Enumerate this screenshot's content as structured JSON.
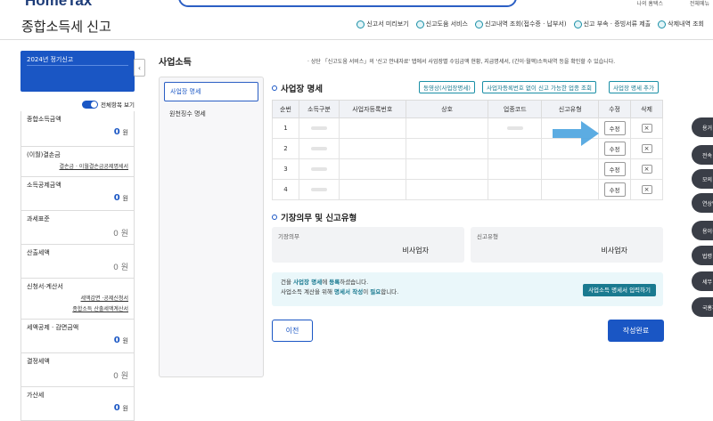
{
  "header": {
    "logo": "HomeTax",
    "top_links": [
      "나의 홈택스",
      "전체메뉴"
    ],
    "page_title": "종합소득세 신고",
    "nav": [
      {
        "label": "신고서 미리보기",
        "icon": "preview-icon"
      },
      {
        "label": "신고도움 서비스",
        "icon": "help-service-icon"
      },
      {
        "label": "신고내역 조회(접수증 · 납부서)",
        "icon": "history-icon"
      },
      {
        "label": "신고 부속 · 증빙서류 제출",
        "icon": "document-upload-icon"
      },
      {
        "label": "삭제내역 조회",
        "icon": "trash-icon"
      }
    ]
  },
  "sidebar": {
    "year_label": "2024년 정기신고",
    "toggle_label": "전체항목 보기",
    "items": [
      {
        "label": "종합소득금액",
        "amount": "0",
        "unit": "원"
      },
      {
        "label": "(이월)결손금",
        "sub": "결손금 · 이월결손금공제명세서"
      },
      {
        "label": "소득공제금액",
        "amount": "0",
        "unit": "원"
      },
      {
        "label": "과세표준",
        "amount": "0",
        "unit": "원"
      },
      {
        "label": "산출세액",
        "amount": "0",
        "unit": "원"
      },
      {
        "label": "신청서·계산서",
        "sub": "세액감면 ·공제신청서",
        "sub2": "종합소득 산출세액계산서"
      },
      {
        "label": "세액공제 · 감면금액",
        "amount": "0",
        "unit": "원"
      },
      {
        "label": "결정세액",
        "amount": "0",
        "unit": "원"
      },
      {
        "label": "가산세",
        "amount": "0",
        "unit": "원"
      }
    ]
  },
  "main": {
    "section_title": "사업소득",
    "notice": "· 상단 「신고도움 서비스」의 '신고 안내자료' 탭에서 사업장별 수입금액 현황, 지급명세서, (간이·월액)소득내역 등을 확인할 수 있습니다.",
    "subnav": [
      "사업장 명세",
      "원천징수 명세"
    ],
    "business_table": {
      "title": "사업장 명세",
      "buttons": [
        "동영상(사업장명세)",
        "사업자등록번호 없이 신고 가능한 업종 조회",
        "사업장 명세 추가"
      ],
      "columns": [
        "순번",
        "소득구분",
        "사업자등록번호",
        "상호",
        "업종코드",
        "신고유형",
        "수정",
        "삭제"
      ],
      "rows": [
        {
          "no": "1",
          "edit": "수정",
          "del": "×"
        },
        {
          "no": "2",
          "edit": "수정",
          "del": "×"
        },
        {
          "no": "3",
          "edit": "수정",
          "del": "×"
        },
        {
          "no": "4",
          "edit": "수정",
          "del": "×"
        }
      ]
    },
    "bookkeeping": {
      "title": "기장의무 및 신고유형",
      "duty_label": "기장의무",
      "duty_value": "비사업자",
      "type_label": "신고유형",
      "type_value": "비사업자"
    },
    "hint": {
      "line1_pre": "건을 ",
      "line1_hl1": "사업장 명세",
      "line1_mid": "에 ",
      "line1_hl2": "등록",
      "line1_post": "하셨습니다.",
      "line2_pre": "사업소득 계산을 위해 ",
      "line2_hl": "명세서 작성",
      "line2_mid": "이 ",
      "line2_hl2": "필요",
      "line2_post": "합니다.",
      "button": "사업소득 명세서 입력하기"
    },
    "prev_button": "이전",
    "done_button": "작성완료"
  },
  "float_bar": [
    "용거",
    "전속",
    "모의",
    "연상담",
    "용이용",
    "법령",
    "세무",
    "국홈채"
  ]
}
